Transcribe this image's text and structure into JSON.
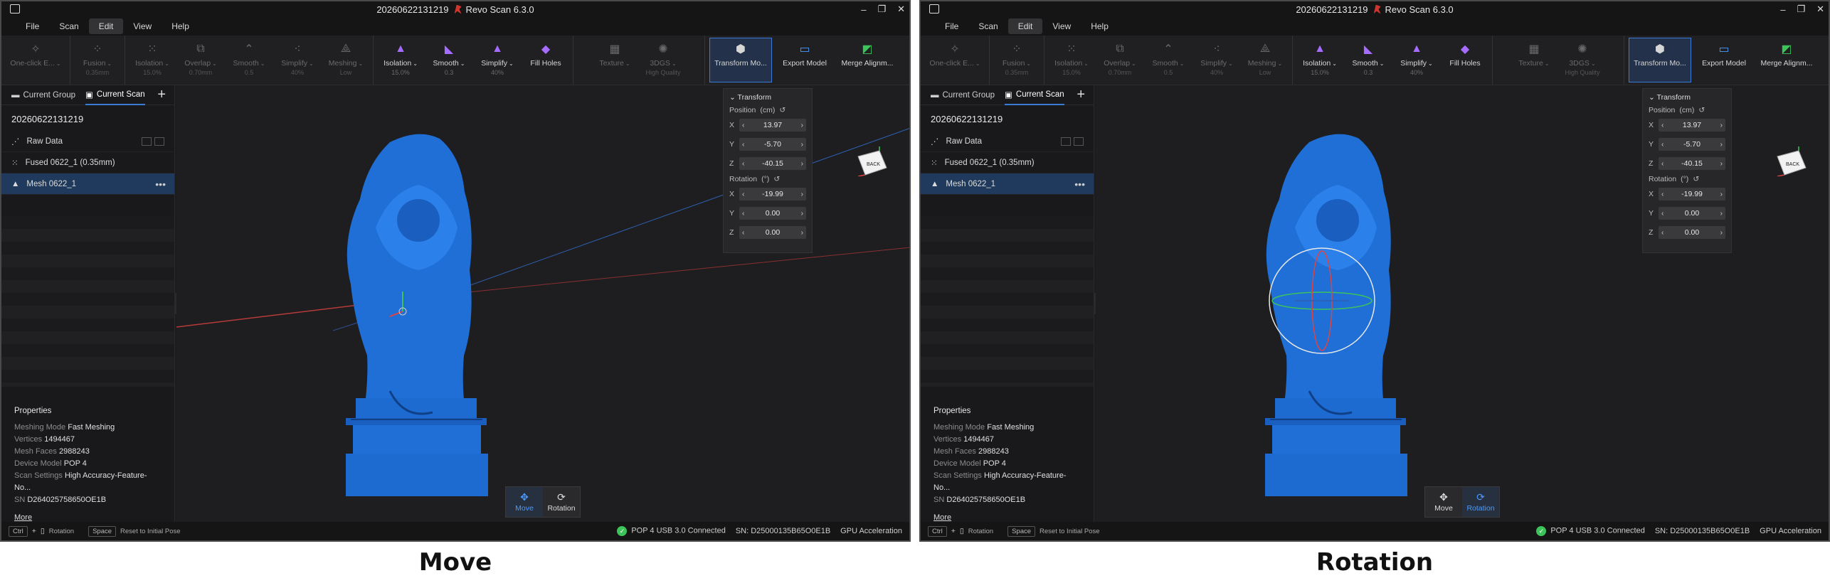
{
  "captions": {
    "left": "Move",
    "right": "Rotation"
  },
  "app": {
    "window_title": "20260622131219",
    "app_name": "Revo Scan 6.3.0"
  },
  "menu": [
    "File",
    "Scan",
    "Edit",
    "View",
    "Help"
  ],
  "toolbar": {
    "oneclick": {
      "label": "One-click E..."
    },
    "fusion": {
      "label": "Fusion",
      "sub": "0.35mm"
    },
    "isolation_dim": {
      "label": "Isolation",
      "sub": "15.0%"
    },
    "overlap": {
      "label": "Overlap",
      "sub": "0.70mm"
    },
    "smooth_dim": {
      "label": "Smooth",
      "sub": "0.5"
    },
    "simplify_dim": {
      "label": "Simplify",
      "sub": "40%"
    },
    "meshing": {
      "label": "Meshing",
      "sub": "Low"
    },
    "isolation": {
      "label": "Isolation",
      "sub": "15.0%"
    },
    "smooth": {
      "label": "Smooth",
      "sub": "0.3"
    },
    "simplify": {
      "label": "Simplify",
      "sub": "40%"
    },
    "fill_holes": {
      "label": "Fill Holes"
    },
    "texture": {
      "label": "Texture"
    },
    "threedgs": {
      "label": "3DGS",
      "sub": "High Quality"
    },
    "transform": {
      "label": "Transform Mo..."
    },
    "export": {
      "label": "Export Model"
    },
    "merge": {
      "label": "Merge Alignm..."
    }
  },
  "leftpanel": {
    "tab_group": "Current Group",
    "tab_scan": "Current Scan",
    "scan_name": "20260622131219",
    "items": [
      {
        "label": "Raw Data"
      },
      {
        "label": "Fused 0622_1 (0.35mm)"
      },
      {
        "label": "Mesh 0622_1"
      }
    ],
    "props_title": "Properties",
    "props": [
      {
        "k": "Meshing Mode",
        "v": "Fast Meshing"
      },
      {
        "k": "Vertices",
        "v": "1494467"
      },
      {
        "k": "Mesh Faces",
        "v": "2988243"
      },
      {
        "k": "Device Model",
        "v": "POP 4"
      },
      {
        "k": "Scan Settings",
        "v": "High Accuracy-Feature-No..."
      },
      {
        "k": "SN",
        "v": "D264025758650OE1B"
      }
    ],
    "more": "More"
  },
  "transform_panel": {
    "title": "Transform",
    "position_label": "Position",
    "position_unit": "(cm)",
    "rotation_label": "Rotation",
    "rotation_unit": "(°)",
    "pos": {
      "x": "13.97",
      "y": "-5.70",
      "z": "-40.15"
    },
    "rot": {
      "x": "-19.99",
      "y": "0.00",
      "z": "0.00"
    },
    "axes": {
      "x": "X",
      "y": "Y",
      "z": "Z"
    }
  },
  "viewcube": {
    "label": "BACK"
  },
  "modes": {
    "move": "Move",
    "rotation": "Rotation"
  },
  "status": {
    "ctrl": "Ctrl",
    "plus": "+",
    "ctrl_hint": "Rotation",
    "space": "Space",
    "space_hint": "Reset to Initial Pose",
    "connection": "POP 4 USB 3.0 Connected",
    "sn": "SN: D25000135B65O0E1B",
    "gpu": "GPU Acceleration"
  },
  "colors": {
    "accent": "#3a7bd5",
    "model": "#1f6fd6",
    "active_mode": "#4a9bff",
    "ok": "#3cc45a"
  }
}
